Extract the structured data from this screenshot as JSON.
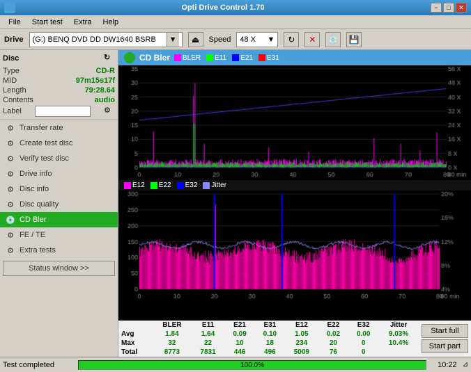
{
  "titlebar": {
    "title": "Opti Drive Control 1.70",
    "min_label": "−",
    "max_label": "□",
    "close_label": "✕"
  },
  "menubar": {
    "items": [
      "File",
      "Start test",
      "Extra",
      "Help"
    ]
  },
  "drivebar": {
    "drive_label": "Drive",
    "drive_value": "(G:)  BENQ DVD DD DW1640 BSRB",
    "speed_label": "Speed",
    "speed_value": "48 X"
  },
  "disc": {
    "header": "Disc",
    "type_label": "Type",
    "type_value": "CD-R",
    "mid_label": "MID",
    "mid_value": "97m15s17f",
    "length_label": "Length",
    "length_value": "79:28.64",
    "contents_label": "Contents",
    "contents_value": "audio",
    "label_label": "Label",
    "label_value": ""
  },
  "sidebar": {
    "items": [
      {
        "id": "transfer-rate",
        "label": "Transfer rate",
        "icon": "⚙"
      },
      {
        "id": "create-test-disc",
        "label": "Create test disc",
        "icon": "⚙"
      },
      {
        "id": "verify-test-disc",
        "label": "Verify test disc",
        "icon": "⚙"
      },
      {
        "id": "drive-info",
        "label": "Drive info",
        "icon": "⚙"
      },
      {
        "id": "disc-info",
        "label": "Disc info",
        "icon": "⚙"
      },
      {
        "id": "disc-quality",
        "label": "Disc quality",
        "icon": "⚙"
      },
      {
        "id": "cd-bler",
        "label": "CD Bler",
        "icon": "💿",
        "active": true
      },
      {
        "id": "fe-te",
        "label": "FE / TE",
        "icon": "⚙"
      },
      {
        "id": "extra-tests",
        "label": "Extra tests",
        "icon": "⚙"
      }
    ],
    "status_window": "Status window >>"
  },
  "chart": {
    "title": "CD Bler",
    "legend_top": [
      "BLER",
      "E11",
      "E21",
      "E31"
    ],
    "legend_bottom": [
      "E12",
      "E22",
      "E32",
      "Jitter"
    ],
    "colors_top": [
      "#ff00ff",
      "#00ff00",
      "#0000ff",
      "#ff0000"
    ],
    "colors_bottom": [
      "#ff00ff",
      "#00ff00",
      "#0000ff",
      "#8080ff"
    ]
  },
  "stats": {
    "headers": [
      "BLER",
      "E11",
      "E21",
      "E31",
      "E12",
      "E22",
      "E32",
      "Jitter"
    ],
    "rows": [
      {
        "label": "Avg",
        "values": [
          "1.84",
          "1.64",
          "0.09",
          "0.10",
          "1.05",
          "0.02",
          "0.00",
          "9.03%"
        ]
      },
      {
        "label": "Max",
        "values": [
          "32",
          "22",
          "10",
          "18",
          "234",
          "20",
          "0",
          "10.4%"
        ]
      },
      {
        "label": "Total",
        "values": [
          "8773",
          "7831",
          "446",
          "496",
          "5009",
          "76",
          "0",
          ""
        ]
      }
    ],
    "start_full": "Start full",
    "start_part": "Start part"
  },
  "statusbar": {
    "status": "Test completed",
    "progress": 100,
    "progress_text": "100.0%",
    "time": "10:22"
  }
}
